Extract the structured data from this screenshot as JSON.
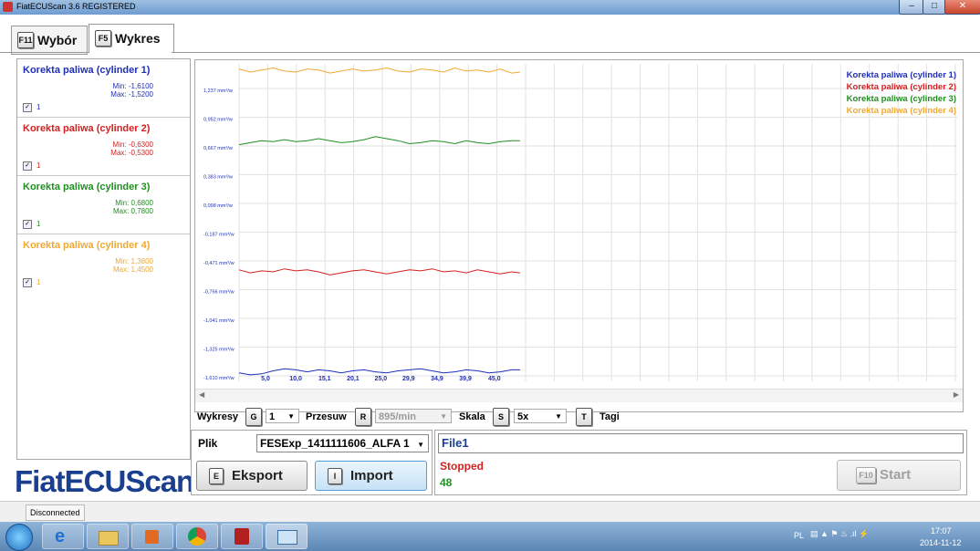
{
  "window": {
    "title": "FiatECUScan 3.6 REGISTERED"
  },
  "tabs": [
    {
      "key": "F11",
      "label": "Wybór"
    },
    {
      "key": "F5",
      "label": "Wykres"
    }
  ],
  "sensors": [
    {
      "name": "Korekta paliwa (cylinder 1)",
      "min": "Min: -1,6100",
      "max": "Max: -1,5200",
      "checked_label": "1",
      "color": "#1f2fb8"
    },
    {
      "name": "Korekta paliwa (cylinder 2)",
      "min": "Min: -0,6300",
      "max": "Max: -0,5300",
      "checked_label": "1",
      "color": "#d42020"
    },
    {
      "name": "Korekta paliwa (cylinder 3)",
      "min": "Min: 0,6800",
      "max": "Max: 0,7800",
      "checked_label": "1",
      "color": "#1f8f1f"
    },
    {
      "name": "Korekta paliwa (cylinder 4)",
      "min": "Min: 1,3800",
      "max": "Max: 1,4500",
      "checked_label": "1",
      "color": "#f0a830"
    }
  ],
  "logo": "FiatECUScan",
  "chart_data": {
    "type": "line",
    "x_ticks": [
      "5,0",
      "10,0",
      "15,1",
      "20,1",
      "25,0",
      "29,9",
      "34,9",
      "39,9",
      "45,0"
    ],
    "y_ticks": [
      "1,237 mm³/w",
      "0,952 mm³/w",
      "0,667 mm³/w",
      "0,383 mm³/w",
      "0,098 mm³/w",
      "-0,187 mm³/w",
      "-0,471 mm³/w",
      "-0,756 mm³/w",
      "-1,041 mm³/w",
      "-1,325 mm³/w",
      "-1,610 mm³/w"
    ],
    "ylim": [
      -1.61,
      1.52
    ],
    "grid": true,
    "legend_position": "top-right",
    "x": [
      0,
      2,
      4,
      6,
      8,
      10,
      12,
      14,
      16,
      18,
      20,
      22,
      24,
      26,
      28,
      30,
      32,
      34,
      36,
      38,
      40,
      42,
      44,
      46,
      48,
      49.5
    ],
    "series": [
      {
        "name": "Korekta paliwa (cylinder 1)",
        "color": "#1f2fb8",
        "values": [
          -1.58,
          -1.6,
          -1.59,
          -1.56,
          -1.54,
          -1.55,
          -1.57,
          -1.55,
          -1.56,
          -1.58,
          -1.56,
          -1.55,
          -1.57,
          -1.58,
          -1.56,
          -1.55,
          -1.54,
          -1.56,
          -1.58,
          -1.57,
          -1.55,
          -1.56,
          -1.58,
          -1.57,
          -1.55,
          -1.55
        ]
      },
      {
        "name": "Korekta paliwa (cylinder 2)",
        "color": "#d42020",
        "values": [
          -0.56,
          -0.59,
          -0.57,
          -0.58,
          -0.55,
          -0.57,
          -0.56,
          -0.58,
          -0.61,
          -0.59,
          -0.57,
          -0.56,
          -0.58,
          -0.6,
          -0.58,
          -0.56,
          -0.57,
          -0.55,
          -0.58,
          -0.57,
          -0.59,
          -0.56,
          -0.58,
          -0.6,
          -0.58,
          -0.59
        ]
      },
      {
        "name": "Korekta paliwa (cylinder 3)",
        "color": "#1f8f1f",
        "values": [
          0.68,
          0.7,
          0.72,
          0.71,
          0.73,
          0.71,
          0.72,
          0.74,
          0.72,
          0.7,
          0.71,
          0.73,
          0.76,
          0.74,
          0.72,
          0.69,
          0.7,
          0.72,
          0.71,
          0.69,
          0.72,
          0.7,
          0.69,
          0.71,
          0.72,
          0.72
        ]
      },
      {
        "name": "Korekta paliwa (cylinder 4)",
        "color": "#f0a830",
        "values": [
          1.43,
          1.4,
          1.42,
          1.44,
          1.41,
          1.4,
          1.43,
          1.42,
          1.39,
          1.41,
          1.43,
          1.41,
          1.42,
          1.44,
          1.41,
          1.4,
          1.43,
          1.42,
          1.4,
          1.44,
          1.41,
          1.42,
          1.4,
          1.43,
          1.39,
          1.4
        ]
      }
    ]
  },
  "controls": {
    "wykresy_label": "Wykresy",
    "wykresy_key": "G",
    "wykresy_value": "1",
    "przesuw_label": "Przesuw",
    "przesuw_key": "R",
    "przesuw_value": "895/min",
    "skala_label": "Skala",
    "skala_key": "S",
    "skala_value": "5x",
    "tagi_key": "T",
    "tagi_label": "Tagi"
  },
  "file": {
    "label": "Plik",
    "value": "FESExp_1411111606_ALFA 1"
  },
  "buttons": {
    "export_key": "E",
    "export_label": "Eksport",
    "import_key": "I",
    "import_label": "Import",
    "start_key": "F10",
    "start_label": "Start"
  },
  "status": {
    "file_name": "File1",
    "state": "Stopped",
    "count": "48"
  },
  "statusbar": {
    "connection": "Disconnected"
  },
  "taskbar": {
    "lang": "PL",
    "time": "17:07",
    "date": "2014-11-12"
  }
}
